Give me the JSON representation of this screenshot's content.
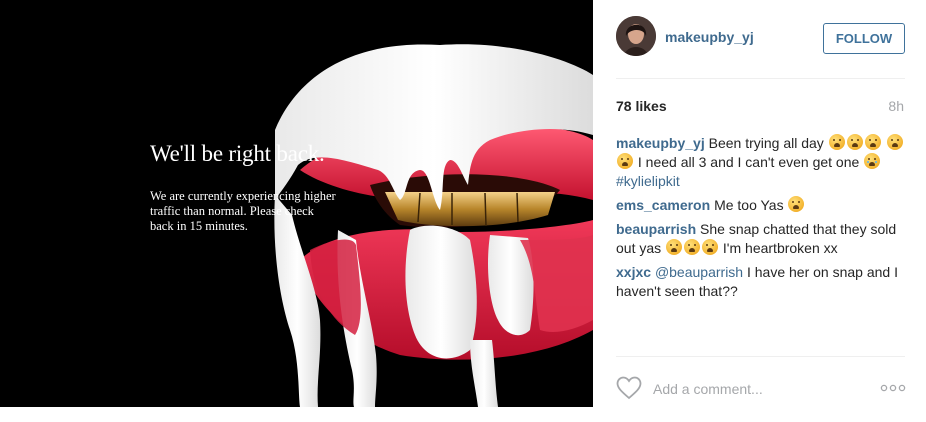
{
  "photo": {
    "overlay_title": "We'll be right back.",
    "overlay_body": "We are currently experiencing higher traffic than normal. Please check back in 15 minutes."
  },
  "header": {
    "username": "makeupby_yj",
    "follow_label": "FOLLOW"
  },
  "stats": {
    "likes": "78 likes",
    "time": "8h"
  },
  "comments": [
    {
      "user": "makeupby_yj",
      "text_1": "Been trying all day",
      "text_2": "I need all 3 and I can't even get one",
      "hashtag": "#kylielipkit"
    },
    {
      "user": "ems_cameron",
      "text": "Me too Yas"
    },
    {
      "user": "beauparrish",
      "text_1": "She snap chatted that they sold out yas",
      "text_2": "I'm heartbroken xx"
    },
    {
      "user": "xxjxc",
      "mention": "@beauparrish",
      "text": "I have her on snap and I haven't seen that??"
    }
  ],
  "footer": {
    "comment_placeholder": "Add a comment...",
    "more_label": "ooo"
  },
  "colors": {
    "link": "#3f6a8e",
    "follow_border": "#3f729b",
    "muted": "#a5a7aa",
    "lip_red": "#e02a4a"
  },
  "icons": [
    "heart-icon",
    "more-options-icon",
    "tired-face-emoji",
    "crying-face-emoji"
  ]
}
